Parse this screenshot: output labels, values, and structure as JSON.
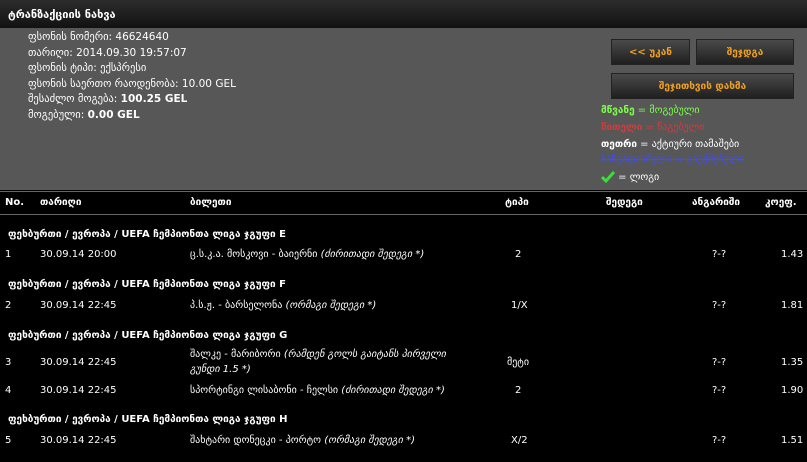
{
  "window": {
    "title": "ტრანზაქციის ნახვა"
  },
  "ticket": {
    "number_label": "ფსონის ნომერი:",
    "number": "46624640",
    "date_label": "თარიღი:",
    "date": "2014.09.30 19:57:07",
    "type_label": "ფსონის ტიპი:",
    "type": "ექსპრესი",
    "stake_label": "ფსონის საერთო რაოდენობა:",
    "stake": "10.00 GEL",
    "possible_label": "შესაძლო მოგება:",
    "possible": "100.25 GEL",
    "win_label": "მოგებული:",
    "win": "0.00 GEL"
  },
  "buttons": {
    "back": "<< უკან",
    "check": "შეჯდგა",
    "stop": "შეჯითხვის დახმა"
  },
  "legend": {
    "green_word": "მწვანე",
    "green_rest": " = მოგებული",
    "red_word": "წითელი",
    "red_rest": " = წაგებული",
    "white_word": "თეთრი",
    "white_rest": " = აქტიური თამაშები",
    "strike_text": "ხაზგადასმული = გაუქმებული",
    "check_text": " = ლოგი",
    "colors": {
      "green": "#7dff4a",
      "red": "#d23b3b",
      "blue": "#3d4dff"
    }
  },
  "headers": {
    "no": "No.",
    "date": "თარიღი",
    "ticket": "ბილეთი",
    "type": "ტიპი",
    "result": "შედეგი",
    "score": "ანგარიში",
    "coef": "კოეფ."
  },
  "groups": [
    {
      "title": "ფეხბურთი / ევროპა / UEFA ჩემპიონთა ლიგა ჯგუფი E"
    },
    {
      "title": "ფეხბურთი / ევროპა / UEFA ჩემპიონთა ლიგა ჯგუფი F"
    },
    {
      "title": "ფეხბურთი / ევროპა / UEFA ჩემპიონთა ლიგა ჯგუფი G"
    },
    {
      "title": "ფეხბურთი / ევროპა / UEFA ჩემპიონთა ლიგა ჯგუფი H"
    }
  ],
  "rows": [
    {
      "no": "1",
      "date": "30.09.14 20:00",
      "match": "ც.ს.კ.ა. მოსკოვი - ბაიერნი",
      "note": "(ძირითადი შედეგი *)",
      "type": "2",
      "score": "?-?",
      "coef": "1.43"
    },
    {
      "no": "2",
      "date": "30.09.14 22:45",
      "match": "პ.ს.ჟ. - ბარსელონა",
      "note": "(ორმაგი შედეგი *)",
      "type": "1/X",
      "score": "?-?",
      "coef": "1.81"
    },
    {
      "no": "3",
      "date": "30.09.14 22:45",
      "match": "შალკე - მარიბორი",
      "note": "(რამდენ გოლს გაიტანს პირველი",
      "note2": "გუნდი 1.5 *)",
      "type": "მეტი",
      "score": "?-?",
      "coef": "1.35"
    },
    {
      "no": "4",
      "date": "30.09.14 22:45",
      "match": "სპორტინგი ლისაბონი - ჩელსი",
      "note": "(ძირითადი შედეგი *)",
      "type": "2",
      "score": "?-?",
      "coef": "1.90"
    },
    {
      "no": "5",
      "date": "30.09.14 22:45",
      "match": "შახტარი დონეცკი - პორტო",
      "note": "(ორმაგი შედეგი *)",
      "type": "X/2",
      "score": "?-?",
      "coef": "1.51"
    }
  ]
}
